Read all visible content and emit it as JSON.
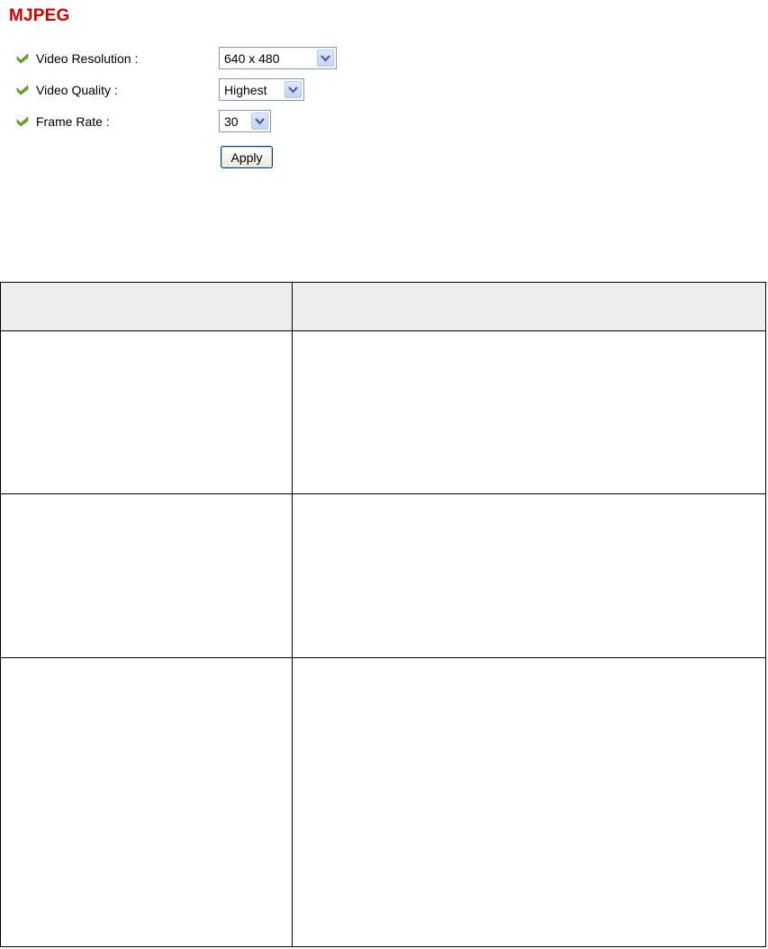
{
  "section_title": "MJPEG",
  "colors": {
    "title": "#d40000",
    "bullet": "#6aaa2a",
    "header_bg": "#eeeeee"
  },
  "fields": [
    {
      "label": "Video Resolution :",
      "value": "640 x 480",
      "icon": "green-check-arrow-icon"
    },
    {
      "label": "Video Quality :",
      "value": "Highest",
      "icon": "green-check-arrow-icon"
    },
    {
      "label": "Frame Rate :",
      "value": "30",
      "icon": "green-check-arrow-icon"
    }
  ],
  "apply_label": "Apply",
  "table": {
    "header": [
      "",
      ""
    ],
    "rows": [
      [
        "",
        ""
      ],
      [
        "",
        ""
      ],
      [
        "",
        ""
      ]
    ]
  }
}
